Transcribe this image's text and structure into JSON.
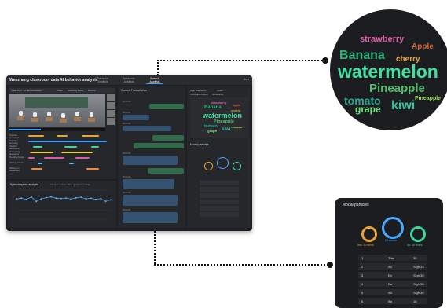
{
  "app": {
    "title": "Wenzhang classroom data AI behavior analysis",
    "nav": [
      "Behavior Analysis",
      "Academic Analysis",
      "Speech Analysis"
    ],
    "user": "User"
  },
  "video_panel": {
    "title": "\"Little Prof\" for demonstration",
    "toolbar": [
      "Class",
      "Teaching Mode",
      "Record"
    ],
    "behavior_rows": [
      "Teacher questions",
      "Teacher lecturing",
      "Student discussion",
      "Answering questions",
      "Reading books",
      "Raising hands",
      "Writing on blackboard"
    ]
  },
  "chart_panel": {
    "title": "Speech speed analysis",
    "legend": "Speaker in class   Other speakers in class"
  },
  "chart_data": {
    "type": "line",
    "x": [
      1,
      2,
      3,
      4,
      5,
      6,
      7,
      8,
      9,
      10,
      11,
      12,
      13,
      14,
      15,
      16,
      17,
      18,
      19,
      20
    ],
    "series": [
      {
        "values": [
          170,
          175,
          165,
          185,
          150,
          170,
          180,
          185,
          175,
          172,
          176,
          168,
          178,
          183,
          170,
          175,
          165,
          172,
          150,
          162
        ]
      }
    ],
    "ylim": [
      0,
      240
    ]
  },
  "transcript": {
    "title": "Speech Transcription",
    "timestamps": [
      "00:00:14",
      "00:00:22",
      "00:00:35",
      "00:01:08",
      "00:01:20",
      "00:01:41",
      "00:02:05",
      "00:02:30"
    ]
  },
  "right_panel": {
    "tabs": [
      "High frequency",
      "Class"
    ],
    "subtabs": [
      "Word distribution",
      "Sentences"
    ],
    "wordcloud_title": "Modal particles"
  },
  "word_cloud": [
    {
      "word": "strawberry",
      "color": "#e05aa6"
    },
    {
      "word": "Apple",
      "color": "#d4643a"
    },
    {
      "word": "Banana",
      "color": "#2db37a"
    },
    {
      "word": "cherry",
      "color": "#e8a23a"
    },
    {
      "word": "watermelon",
      "color": "#3fe0a0"
    },
    {
      "word": "Pineapple",
      "color": "#4fbf6a"
    },
    {
      "word": "tomato",
      "color": "#2aa890"
    },
    {
      "word": "grape",
      "color": "#6fe07a"
    },
    {
      "word": "kiwi",
      "color": "#35c4a0"
    },
    {
      "word": "Pineapple",
      "color": "#9ae05a"
    }
  ],
  "modal_card": {
    "title": "Modal particles",
    "stats": [
      {
        "label": "This: 32 times",
        "color": "#e8a23a"
      },
      {
        "label": "Of course",
        "color": "#4aa8ff"
      },
      {
        "label": "So: 10 times",
        "color": "#3fd49a"
      }
    ],
    "rows": [
      [
        "1",
        "This",
        "30"
      ],
      [
        "2",
        "Ah",
        "Sigh 33"
      ],
      [
        "3",
        "Eh",
        "Sigh 30"
      ],
      [
        "4",
        "Ba",
        "Sigh 36"
      ],
      [
        "5",
        "Ah",
        "Sigh 30"
      ],
      [
        "6",
        "Ba",
        "16"
      ]
    ]
  }
}
